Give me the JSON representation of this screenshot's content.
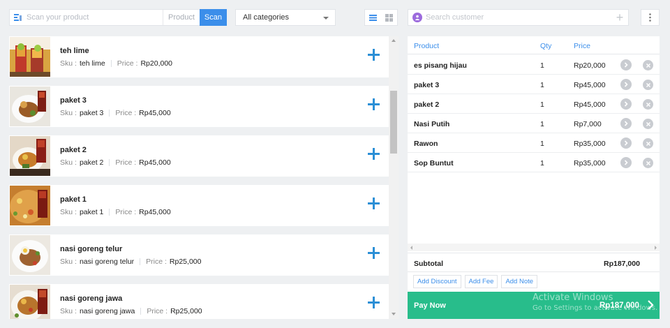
{
  "scan": {
    "placeholder": "Scan your product",
    "mode_product": "Product",
    "mode_scan": "Scan"
  },
  "category": {
    "selected": "All categories"
  },
  "customer": {
    "placeholder": "Search customer"
  },
  "products": [
    {
      "name": "teh lime",
      "sku_label": "Sku :",
      "sku": "teh lime",
      "price_label": "Price :",
      "price": "Rp20,000"
    },
    {
      "name": "paket 3",
      "sku_label": "Sku :",
      "sku": "paket 3",
      "price_label": "Price :",
      "price": "Rp45,000"
    },
    {
      "name": "paket 2",
      "sku_label": "Sku :",
      "sku": "paket 2",
      "price_label": "Price :",
      "price": "Rp45,000"
    },
    {
      "name": "paket 1",
      "sku_label": "Sku :",
      "sku": "paket 1",
      "price_label": "Price :",
      "price": "Rp45,000"
    },
    {
      "name": "nasi goreng telur",
      "sku_label": "Sku :",
      "sku": "nasi goreng telur",
      "price_label": "Price :",
      "price": "Rp25,000"
    },
    {
      "name": "nasi goreng jawa",
      "sku_label": "Sku :",
      "sku": "nasi goreng jawa",
      "price_label": "Price :",
      "price": "Rp25,000"
    }
  ],
  "cart": {
    "headers": {
      "product": "Product",
      "qty": "Qty",
      "price": "Price"
    },
    "items": [
      {
        "name": "es pisang hijau",
        "qty": "1",
        "price": "Rp20,000"
      },
      {
        "name": "paket 3",
        "qty": "1",
        "price": "Rp45,000"
      },
      {
        "name": "paket 2",
        "qty": "1",
        "price": "Rp45,000"
      },
      {
        "name": "Nasi Putih",
        "qty": "1",
        "price": "Rp7,000"
      },
      {
        "name": "Rawon",
        "qty": "1",
        "price": "Rp35,000"
      },
      {
        "name": "Sop Buntut",
        "qty": "1",
        "price": "Rp35,000"
      }
    ],
    "subtotal_label": "Subtotal",
    "subtotal_value": "Rp187,000",
    "add_discount": "Add Discount",
    "add_fee": "Add Fee",
    "add_note": "Add Note",
    "pay_label": "Pay Now",
    "pay_amount": "Rp187,000"
  },
  "watermark": {
    "line1": "Activate Windows",
    "line2": "Go to Settings to activate Windows."
  },
  "colors": {
    "accent": "#3b8eea",
    "pay_green": "#28bd8b",
    "plus_blue": "#2b8fd6"
  }
}
